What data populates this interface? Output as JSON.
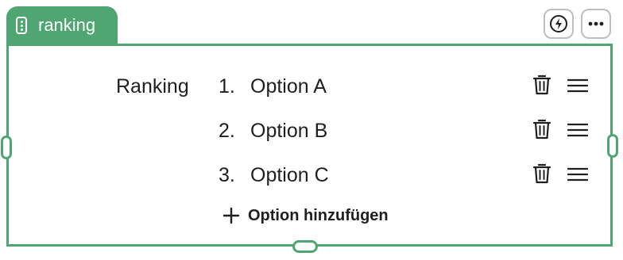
{
  "block": {
    "type_label": "ranking",
    "type_icon": "vertical-dots-card-icon"
  },
  "toolbar": {
    "action_icon": "lightning-bolt-icon",
    "more_icon": "more-horizontal-icon"
  },
  "question": {
    "label": "Ranking",
    "options": [
      {
        "number": "1.",
        "label": "Option A"
      },
      {
        "number": "2.",
        "label": "Option B"
      },
      {
        "number": "3.",
        "label": "Option C"
      }
    ],
    "row_icons": {
      "delete": "trash-icon",
      "reorder": "drag-handle-icon"
    },
    "add_option_label": "Option hinzufügen",
    "add_icon": "plus-icon"
  },
  "colors": {
    "accent": "#4fa673",
    "text": "#1f1f1f",
    "button_border": "#bfbfbf"
  }
}
